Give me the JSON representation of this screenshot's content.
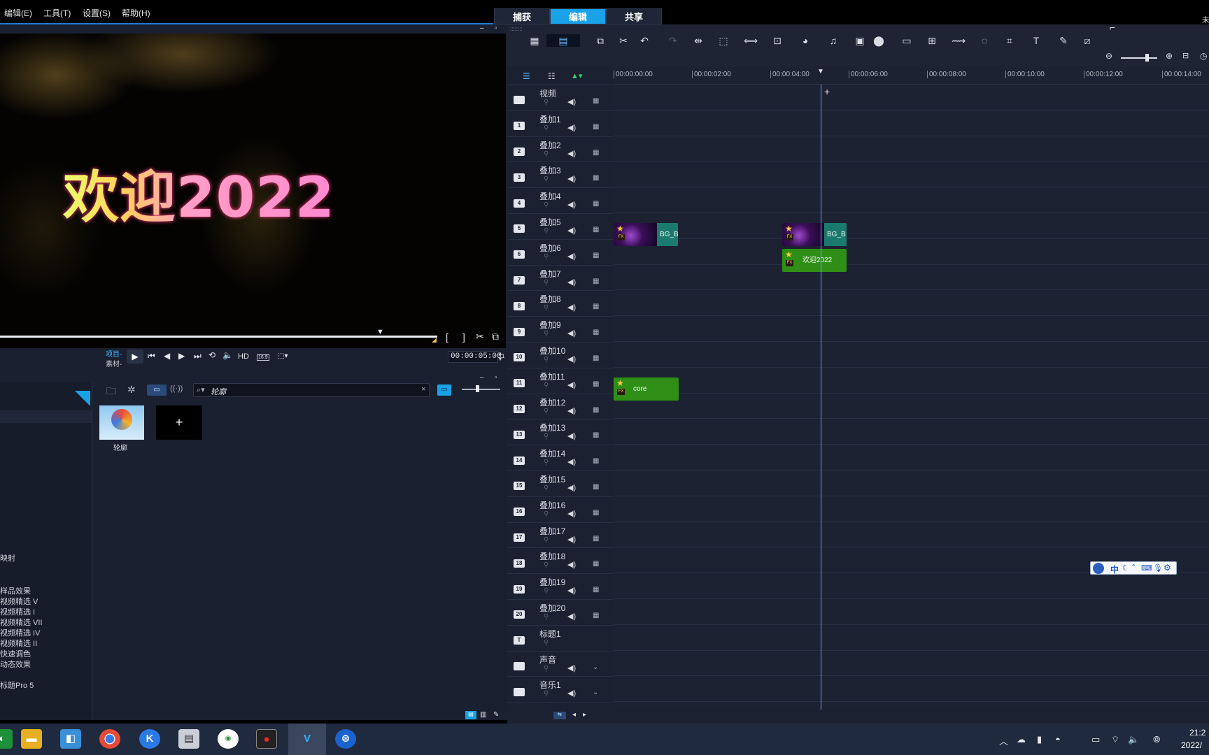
{
  "menu": {
    "items": [
      "编辑(E)",
      "工具(T)",
      "设置(S)",
      "帮助(H)"
    ]
  },
  "mode_tabs": [
    {
      "label": "捕获"
    },
    {
      "label": "编辑"
    },
    {
      "label": "共享"
    }
  ],
  "preview": {
    "title_overlay": "欢迎2022",
    "mode_project": "项目-",
    "mode_clip": "素材-",
    "hd_label": "HD",
    "aspect": "16:9",
    "timecode": "00:00:05:00",
    "timecode_frames": "1"
  },
  "library": {
    "search_value": "轮廓",
    "categories": [
      "映射",
      "样品效果",
      "视频精选 V",
      "视频精选 I",
      "视频精选 VII",
      "视频精选 IV",
      "视频精选 II",
      "快速调色",
      "动态效果",
      "标题Pro 5"
    ],
    "thumb_label": "轮廓",
    "add_symbol": "+"
  },
  "timeline": {
    "ruler": [
      "00:00:00:00",
      "00:00:02:00",
      "00:00:04:00",
      "00:00:06:00",
      "00:00:08:00",
      "00:00:10:00",
      "00:00:12:00",
      "00:00:14:00"
    ],
    "tracks": [
      {
        "num": "",
        "name": "视频"
      },
      {
        "num": "1",
        "name": "叠加1"
      },
      {
        "num": "2",
        "name": "叠加2"
      },
      {
        "num": "3",
        "name": "叠加3"
      },
      {
        "num": "4",
        "name": "叠加4"
      },
      {
        "num": "5",
        "name": "叠加5"
      },
      {
        "num": "6",
        "name": "叠加6"
      },
      {
        "num": "7",
        "name": "叠加7"
      },
      {
        "num": "8",
        "name": "叠加8"
      },
      {
        "num": "9",
        "name": "叠加9"
      },
      {
        "num": "10",
        "name": "叠加10"
      },
      {
        "num": "11",
        "name": "叠加11"
      },
      {
        "num": "12",
        "name": "叠加12"
      },
      {
        "num": "13",
        "name": "叠加13"
      },
      {
        "num": "14",
        "name": "叠加14"
      },
      {
        "num": "15",
        "name": "叠加15"
      },
      {
        "num": "16",
        "name": "叠加16"
      },
      {
        "num": "17",
        "name": "叠加17"
      },
      {
        "num": "18",
        "name": "叠加18"
      },
      {
        "num": "19",
        "name": "叠加19"
      },
      {
        "num": "20",
        "name": "叠加20"
      },
      {
        "num": "T",
        "name": "标题1"
      },
      {
        "num": "",
        "name": "声音"
      },
      {
        "num": "",
        "name": "音乐1"
      }
    ],
    "clips": {
      "bg_label_1": "BG_B",
      "bg_label_2": "BG_B",
      "title_clip": "欢迎2022",
      "core_clip": "core",
      "fx_tag": "FX"
    }
  },
  "ime": {
    "label": "中"
  },
  "clock": {
    "time": "21:2",
    "date": "2022/"
  },
  "corner_text": "未"
}
